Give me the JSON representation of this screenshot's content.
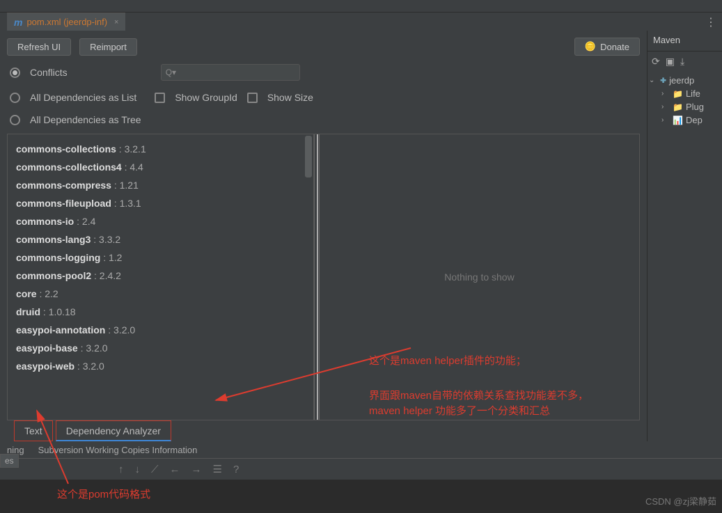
{
  "tab": {
    "icon": "m",
    "label": "pom.xml (jeerdp-inf)",
    "close": "×"
  },
  "toolbar": {
    "refresh": "Refresh UI",
    "reimport": "Reimport",
    "donate": "Donate",
    "gear": "⋮"
  },
  "filters": {
    "conflicts": "Conflicts",
    "all_list": "All Dependencies as List",
    "all_tree": "All Dependencies as Tree",
    "search_icon": "Q▾",
    "show_groupid": "Show GroupId",
    "show_size": "Show Size"
  },
  "deps": [
    {
      "name": "commons-collections",
      "ver": "3.2.1"
    },
    {
      "name": "commons-collections4",
      "ver": "4.4"
    },
    {
      "name": "commons-compress",
      "ver": "1.21"
    },
    {
      "name": "commons-fileupload",
      "ver": "1.3.1"
    },
    {
      "name": "commons-io",
      "ver": "2.4"
    },
    {
      "name": "commons-lang3",
      "ver": "3.3.2"
    },
    {
      "name": "commons-logging",
      "ver": "1.2"
    },
    {
      "name": "commons-pool2",
      "ver": "2.4.2"
    },
    {
      "name": "core",
      "ver": "2.2"
    },
    {
      "name": "druid",
      "ver": "1.0.18"
    },
    {
      "name": "easypoi-annotation",
      "ver": "3.2.0"
    },
    {
      "name": "easypoi-base",
      "ver": "3.2.0"
    },
    {
      "name": "easypoi-web",
      "ver": "3.2.0"
    }
  ],
  "empty": "Nothing to show",
  "bottom_tabs": {
    "text": "Text",
    "analyzer": "Dependency Analyzer"
  },
  "status": {
    "svn": "Subversion Working Copies Information",
    "ning": "ning"
  },
  "lower_icons": [
    "↑",
    "↓",
    "⟋",
    "←",
    "→",
    "☰",
    "?"
  ],
  "left_label": "es",
  "maven": {
    "title": "Maven",
    "tree": [
      {
        "indent": 0,
        "chev": "⌄",
        "icon": "🞧",
        "label": "jeerdp"
      },
      {
        "indent": 1,
        "chev": "›",
        "icon": "📁",
        "label": "Life"
      },
      {
        "indent": 1,
        "chev": "›",
        "icon": "📁",
        "label": "Plug"
      },
      {
        "indent": 1,
        "chev": "›",
        "icon": "📊",
        "label": "Dep"
      }
    ],
    "icons": [
      "⟳",
      "▣",
      "⤓"
    ]
  },
  "annot": {
    "a1": "这个是maven helper插件的功能；",
    "a2": "界面跟maven自带的依赖关系查找功能差不多，",
    "a3": "maven helper 功能多了一个分类和汇总",
    "a4": "这个是pom代码格式"
  },
  "watermark": "CSDN @zj梁静茹"
}
